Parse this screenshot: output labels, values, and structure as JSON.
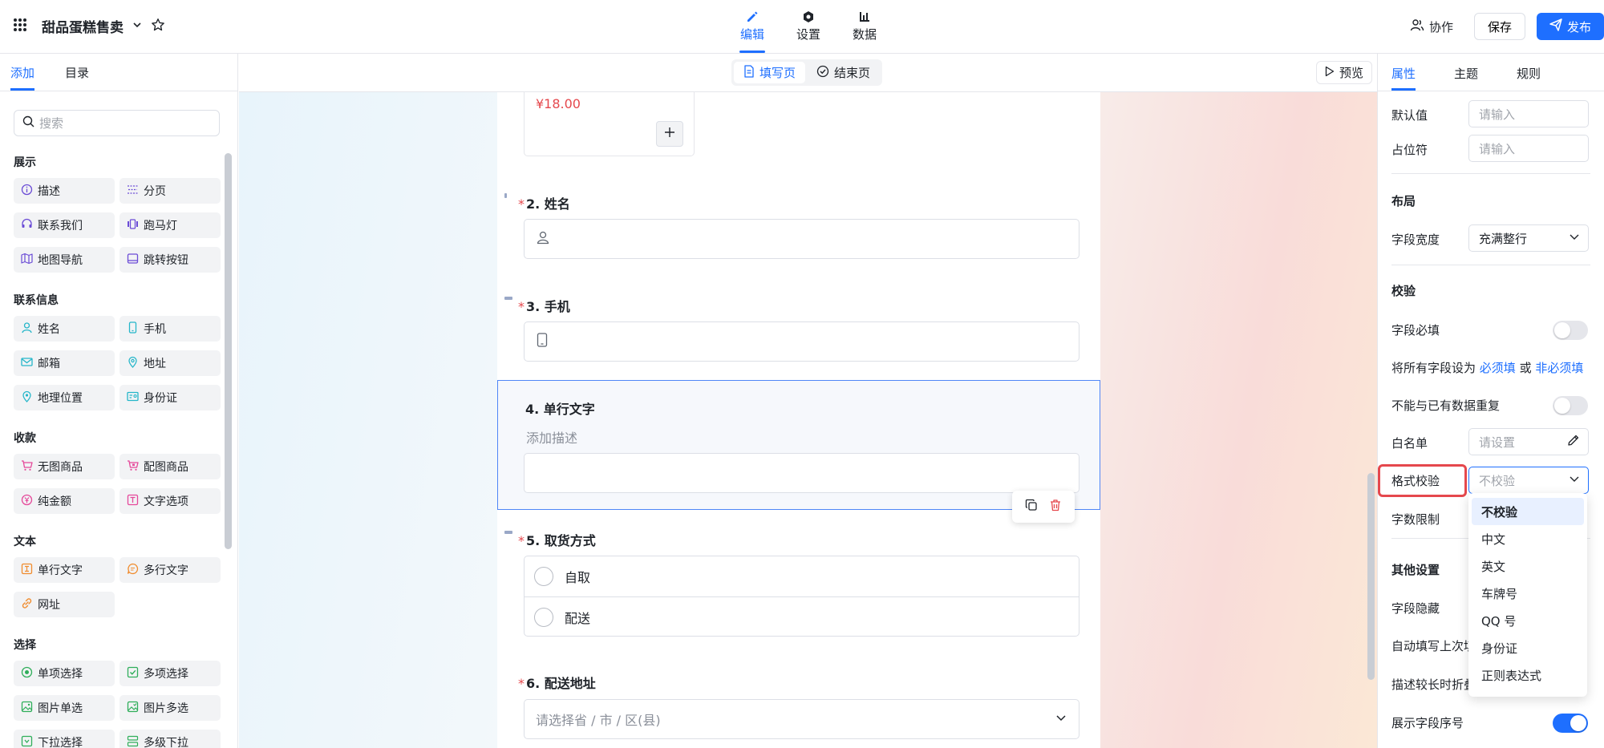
{
  "app": {
    "title": "甜品蛋糕售卖"
  },
  "top_tabs": [
    {
      "label": "编辑"
    },
    {
      "label": "设置"
    },
    {
      "label": "数据"
    }
  ],
  "actions": {
    "collab": "协作",
    "save": "保存",
    "publish": "发布"
  },
  "left": {
    "tabs": [
      {
        "label": "添加"
      },
      {
        "label": "目录"
      }
    ],
    "search_placeholder": "搜索",
    "sections": [
      {
        "title": "展示",
        "items": [
          "描述",
          "分页",
          "联系我们",
          "跑马灯",
          "地图导航",
          "跳转按钮"
        ]
      },
      {
        "title": "联系信息",
        "items": [
          "姓名",
          "手机",
          "邮箱",
          "地址",
          "地理位置",
          "身份证"
        ]
      },
      {
        "title": "收款",
        "items": [
          "无图商品",
          "配图商品",
          "纯金额",
          "文字选项"
        ]
      },
      {
        "title": "文本",
        "items": [
          "单行文字",
          "多行文字",
          "网址"
        ]
      },
      {
        "title": "选择",
        "items": [
          "单项选择",
          "多项选择",
          "图片单选",
          "图片多选",
          "下拉选择",
          "多级下拉"
        ]
      }
    ]
  },
  "subbar": {
    "fill_page": "填写页",
    "end_page": "结束页",
    "preview": "预览"
  },
  "form": {
    "price": "¥18.00",
    "questions": [
      {
        "label": "2. 姓名",
        "required": true
      },
      {
        "label": "3. 手机",
        "required": true
      },
      {
        "label": "4. 单行文字",
        "required": false,
        "description": "添加描述"
      },
      {
        "label": "5. 取货方式",
        "required": true,
        "options": [
          "自取",
          "配送"
        ]
      },
      {
        "label": "6. 配送地址",
        "required": true,
        "placeholder": "请选择省 / 市 / 区(县)"
      }
    ]
  },
  "right": {
    "tabs": [
      {
        "label": "属性"
      },
      {
        "label": "主题"
      },
      {
        "label": "规则"
      }
    ],
    "default_value": {
      "label": "默认值",
      "placeholder": "请输入"
    },
    "placeholder_field": {
      "label": "占位符",
      "placeholder": "请输入"
    },
    "layout_head": "布局",
    "field_width": {
      "label": "字段宽度",
      "value": "充满整行"
    },
    "validation_head": "校验",
    "required_field": {
      "label": "字段必填",
      "on": false
    },
    "set_all": {
      "prefix": "将所有字段设为",
      "required": "必须填",
      "or": "或",
      "not_required": "非必须填"
    },
    "no_duplicate": {
      "label": "不能与已有数据重复",
      "on": false
    },
    "whitelist": {
      "label": "白名单",
      "placeholder": "请设置"
    },
    "format_check": {
      "label": "格式校验",
      "value": "不校验"
    },
    "char_limit": {
      "label": "字数限制"
    },
    "other_head": "其他设置",
    "field_hide": {
      "label": "字段隐藏"
    },
    "autofill": {
      "label": "自动填写上次填"
    },
    "collapse_desc": {
      "label": "描述较长时折叠"
    },
    "show_index": {
      "label": "展示字段序号",
      "on": true
    }
  },
  "dropdown": {
    "options": [
      "不校验",
      "中文",
      "英文",
      "车牌号",
      "QQ 号",
      "身份证",
      "正则表达式"
    ],
    "selected": "不校验"
  },
  "colors": {
    "accent": "#1e6fff",
    "danger": "#e5484d"
  }
}
